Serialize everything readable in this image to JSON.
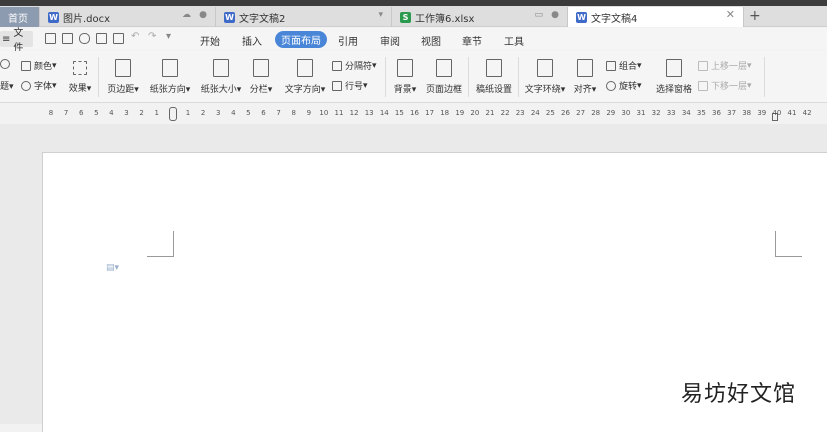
{
  "tabs": [
    {
      "label": "首页"
    },
    {
      "label": "图片.docx",
      "icon": "word-icon"
    },
    {
      "label": "文字文稿2",
      "icon": "word-icon"
    },
    {
      "label": "工作簿6.xlsx",
      "icon": "sheet-icon"
    },
    {
      "label": "文字文稿4",
      "icon": "word-icon",
      "active": true
    }
  ],
  "new_tab": "+",
  "menubar": {
    "file": "文件",
    "items": [
      "开始",
      "插入",
      "页面布局",
      "引用",
      "审阅",
      "视图",
      "章节",
      "工具"
    ],
    "active": "页面布局"
  },
  "ribbon": {
    "color": "颜色",
    "font": "字体",
    "effect": "效果",
    "margins": "页边距",
    "orientation": "纸张方向",
    "size": "纸张大小",
    "columns": "分栏",
    "text_direction": "文字方向",
    "separator": "分隔符",
    "line_number": "行号",
    "background": "背景",
    "page_border": "页面边框",
    "manuscript": "稿纸设置",
    "text_wrap": "文字环绕",
    "align": "对齐",
    "group": "组合",
    "rotate": "旋转",
    "select_pane": "选择窗格",
    "bring_forward": "上移一层",
    "send_backward": "下移一层"
  },
  "ruler_left": [
    "8",
    "7",
    "6",
    "5",
    "4",
    "3",
    "2",
    "1"
  ],
  "ruler_right": [
    "1",
    "2",
    "3",
    "4",
    "5",
    "6",
    "7",
    "8",
    "9",
    "10",
    "11",
    "12",
    "13",
    "14",
    "15",
    "16",
    "17",
    "18",
    "19",
    "20",
    "21",
    "22",
    "23",
    "24",
    "25",
    "26",
    "27",
    "28",
    "29",
    "30",
    "31",
    "32",
    "33",
    "34",
    "35",
    "36",
    "37",
    "38",
    "39",
    "40",
    "41",
    "42"
  ],
  "watermark": "易坊好文馆"
}
